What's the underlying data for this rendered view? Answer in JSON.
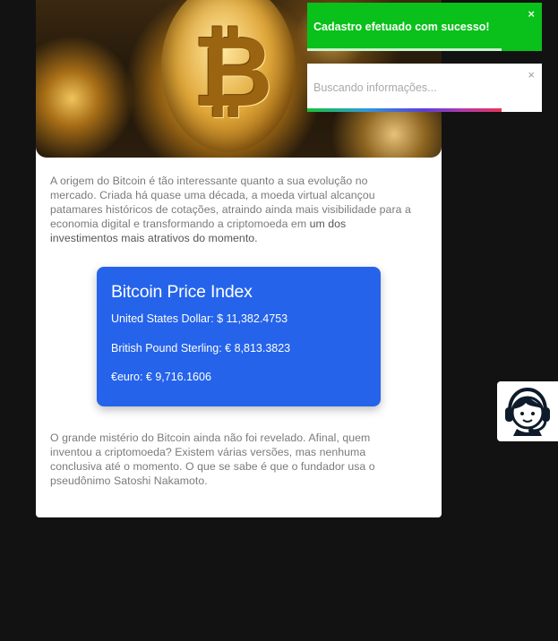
{
  "article": {
    "paragraph1": "A origem do Bitcoin é tão interessante quanto a sua evolução no mercado. Criada há quase uma década, a moeda virtual alcançou patamares históricos de cotações, atraindo ainda mais visibilidade para a economia digital e transformando a criptomoeda em",
    "paragraph1_strong": "um dos investimentos mais atrativos do momento.",
    "paragraph2": "O grande mistério do Bitcoin ainda não foi revelado. Afinal, quem inventou a criptomoeda? Existem várias versões, mas nenhuma conclusiva até o momento. O que se sabe é que o fundador usa o pseudônimo Satoshi Nakamoto.",
    "hero_icon": "bitcoin-coins-photo"
  },
  "price_index": {
    "title": "Bitcoin Price Index",
    "usd": "United States Dollar: $ 11,382.4753",
    "gbp": "British Pound Sterling: € 8,813.3823",
    "eur": "€euro: € 9,716.1606",
    "color": "#2563eb"
  },
  "toasts": {
    "success": {
      "message": "Cadastro efetuado com sucesso!",
      "close": "×",
      "color": "#09c11a",
      "progress": 0.83
    },
    "info": {
      "message": "Buscando informações...",
      "close": "×",
      "progress": 0.83
    }
  },
  "support": {
    "icon": "support-agent-headset-icon"
  }
}
